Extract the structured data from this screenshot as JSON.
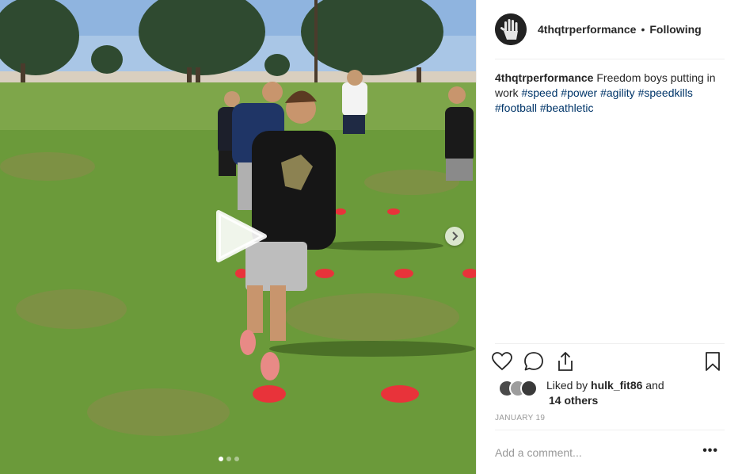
{
  "post": {
    "username": "4thqtrperformance",
    "separator": "•",
    "follow_state": "Following",
    "caption": {
      "username": "4thqtrperformance",
      "text": "Freedom boys putting in work",
      "hashtags": [
        "#speed",
        "#power",
        "#agility",
        "#speedkills",
        "#football",
        "#beathletic"
      ]
    },
    "likes": {
      "prefix": "Liked by",
      "user": "hulk_fit86",
      "joiner": "and",
      "others": "14 others"
    },
    "date": "JANUARY 19",
    "comment_placeholder": "Add a comment...",
    "more_options": "•••"
  },
  "media": {
    "type": "video",
    "carousel_dots": 3,
    "active_dot": 0
  },
  "icons": [
    "heart-icon",
    "comment-icon",
    "share-icon",
    "bookmark-icon",
    "play-icon",
    "chevron-right-icon"
  ],
  "colors": {
    "text": "#262626",
    "hashtag": "#003569",
    "muted": "#999999",
    "cone": "#e8333a",
    "grass": "#5f8a35"
  }
}
